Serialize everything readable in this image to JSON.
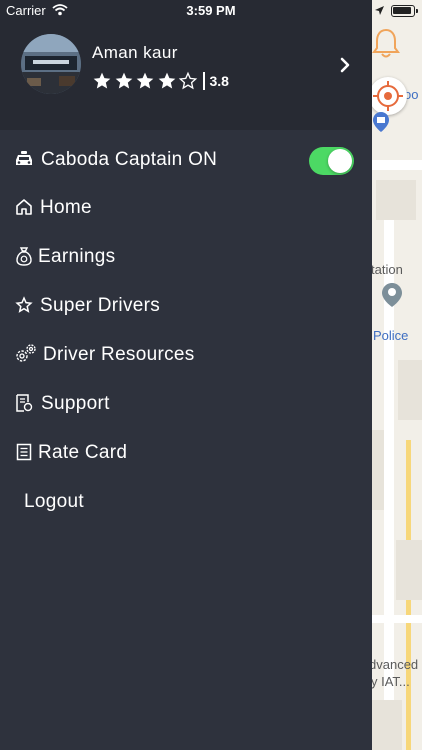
{
  "status_bar": {
    "carrier": "Carrier",
    "time": "3:59 PM"
  },
  "map": {
    "label_station": "tation",
    "label_police": "Police",
    "label_advanced_1": "dvanced",
    "label_advanced_2": "y IAT...",
    "label_top": "oo"
  },
  "profile": {
    "name": "Aman kaur",
    "rating": "3.8",
    "stars_filled": 4,
    "stars_total": 5
  },
  "menu": {
    "captain_label": "Caboda Captain ON",
    "captain_toggle_on": true,
    "items": [
      {
        "label": "Home",
        "icon": "home-icon"
      },
      {
        "label": "Earnings",
        "icon": "money-bag-icon"
      },
      {
        "label": "Super Drivers",
        "icon": "star-icon"
      },
      {
        "label": "Driver Resources",
        "icon": "gears-icon"
      },
      {
        "label": "Support",
        "icon": "support-doc-icon"
      },
      {
        "label": "Rate Card",
        "icon": "list-doc-icon"
      }
    ],
    "logout_label": "Logout"
  },
  "colors": {
    "drawer_bg": "#2e323d",
    "header_bg": "#272a33",
    "toggle_on": "#4cd964",
    "bell_accent": "#f0a45a"
  }
}
